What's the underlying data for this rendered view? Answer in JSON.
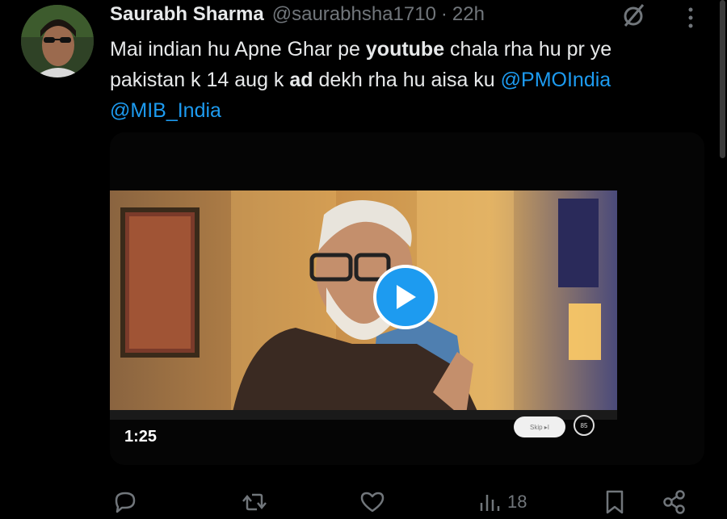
{
  "tweet": {
    "author_name": "Saurabh Sharma",
    "handle": "@saurabhsha1710",
    "separator": "·",
    "time": "22h",
    "text_parts": [
      "Mai indian hu Apne Ghar pe ",
      "youtube",
      " chala rha hu pr ye pakistan k 14 aug k  ",
      "ad",
      " dekh rha hu aisa ku "
    ],
    "mentions": [
      "@PMOIndia",
      "@MIB_India"
    ]
  },
  "video": {
    "duration_label": "1:25",
    "skip_label": "Skip ▸I",
    "counter_label": "85"
  },
  "actions": {
    "views_count": "18"
  },
  "colors": {
    "accent": "#1d9bf0",
    "background": "#000000",
    "muted": "#71767b"
  },
  "icons": [
    "grok-icon",
    "more-icon",
    "play-icon",
    "reply-icon",
    "retweet-icon",
    "like-icon",
    "views-icon",
    "bookmark-icon",
    "share-icon"
  ]
}
